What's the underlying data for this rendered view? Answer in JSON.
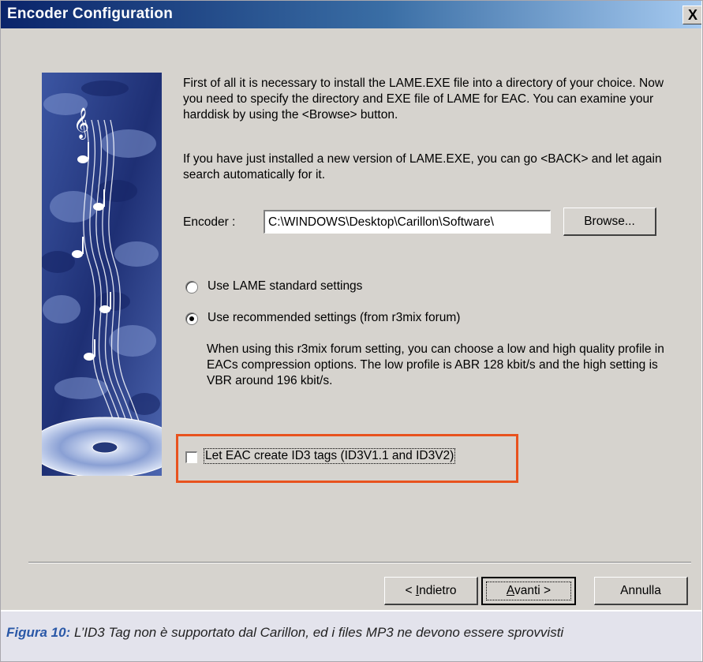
{
  "window": {
    "title": "Encoder Configuration",
    "close_symbol": "X"
  },
  "content": {
    "paragraph1": "First of all it is necessary to install the LAME.EXE file into a directory of your choice. Now you need to specify the directory and EXE file of LAME for EAC. You can examine your harddisk by using the <Browse> button.",
    "paragraph2": "If you have just installed a new version of LAME.EXE, you can go <BACK> and let again search automatically for it.",
    "encoder_label": "Encoder :",
    "encoder_value": "C:\\WINDOWS\\Desktop\\Carillon\\Software\\",
    "browse_label": "Browse...",
    "radio_options": [
      {
        "label": "Use LAME standard settings",
        "selected": false
      },
      {
        "label": "Use recommended settings  (from r3mix forum)",
        "selected": true
      }
    ],
    "paragraph3": "When using this r3mix forum setting, you can choose a low and high quality profile in EACs compression options. The low profile is ABR 128 kbit/s and the high setting is VBR around 196 kbit/s.",
    "id3_checkbox": {
      "label": "Let EAC create ID3 tags (ID3V1.1 and ID3V2)",
      "checked": false
    }
  },
  "buttons": {
    "back_prefix": "< ",
    "back_accel": "I",
    "back_rest": "ndietro",
    "next_accel": "A",
    "next_rest": "vanti >",
    "cancel": "Annulla"
  },
  "caption": {
    "lead": "Figura 10:",
    "text": " L’ID3 Tag non è supportato dal Carillon, ed i files MP3 ne devono essere sprovvisti"
  },
  "colors": {
    "title_gradient_start": "#0a246a",
    "title_gradient_end": "#a6caf0",
    "highlight_border": "#e8521e",
    "caption_lead": "#2a58a7",
    "dialog_face": "#d6d3ce"
  }
}
